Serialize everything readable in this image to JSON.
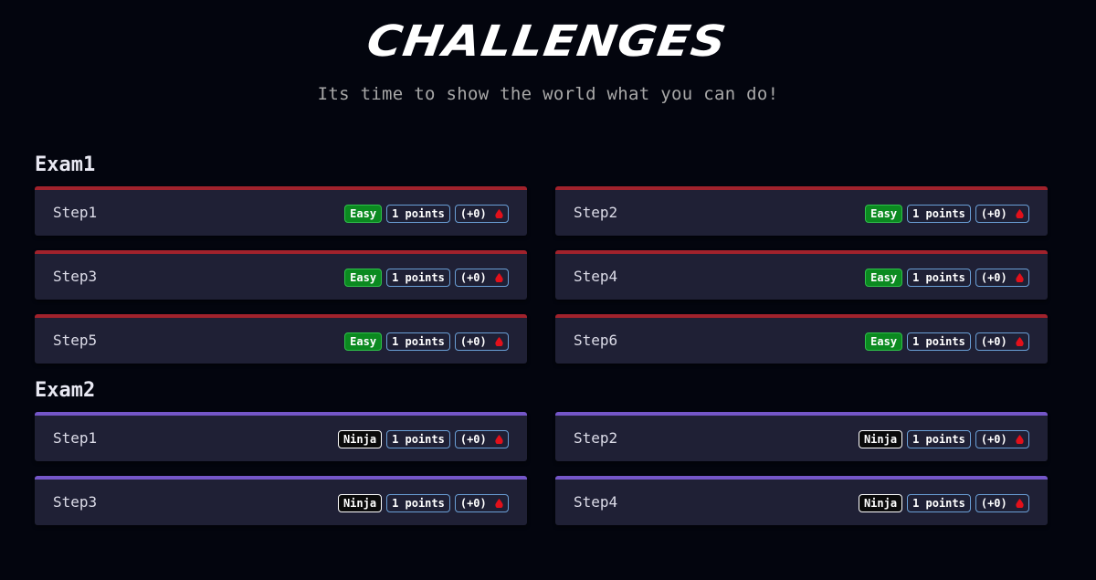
{
  "header": {
    "title": "CHALLENGES",
    "subtitle": "Its time to show the world what you can do!"
  },
  "colors": {
    "background": "#03050e",
    "card": "#1f2035",
    "easy_accent": "#a1222c",
    "ninja_accent": "#7456c8",
    "easy_badge": "#0b8a20",
    "blood_drop": "#e2101a"
  },
  "sections": [
    {
      "title": "Exam1",
      "challenges": [
        {
          "name": "Step1",
          "difficulty": "Easy",
          "points": "1 points",
          "bonus": "(+0)"
        },
        {
          "name": "Step2",
          "difficulty": "Easy",
          "points": "1 points",
          "bonus": "(+0)"
        },
        {
          "name": "Step3",
          "difficulty": "Easy",
          "points": "1 points",
          "bonus": "(+0)"
        },
        {
          "name": "Step4",
          "difficulty": "Easy",
          "points": "1 points",
          "bonus": "(+0)"
        },
        {
          "name": "Step5",
          "difficulty": "Easy",
          "points": "1 points",
          "bonus": "(+0)"
        },
        {
          "name": "Step6",
          "difficulty": "Easy",
          "points": "1 points",
          "bonus": "(+0)"
        }
      ]
    },
    {
      "title": "Exam2",
      "challenges": [
        {
          "name": "Step1",
          "difficulty": "Ninja",
          "points": "1 points",
          "bonus": "(+0)"
        },
        {
          "name": "Step2",
          "difficulty": "Ninja",
          "points": "1 points",
          "bonus": "(+0)"
        },
        {
          "name": "Step3",
          "difficulty": "Ninja",
          "points": "1 points",
          "bonus": "(+0)"
        },
        {
          "name": "Step4",
          "difficulty": "Ninja",
          "points": "1 points",
          "bonus": "(+0)"
        }
      ]
    }
  ]
}
